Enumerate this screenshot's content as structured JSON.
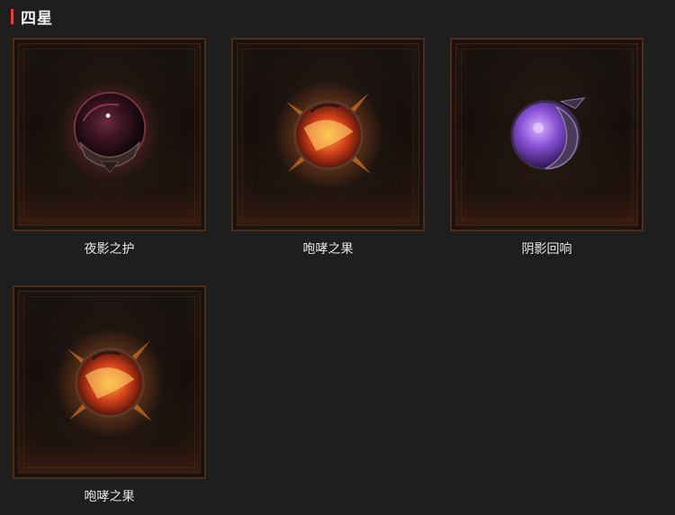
{
  "section": {
    "title": "四星"
  },
  "items": [
    {
      "name": "夜影之护",
      "icon": "dark-nebula-orb-icon"
    },
    {
      "name": "咆哮之果",
      "icon": "flame-fruit-icon"
    },
    {
      "name": "阴影回响",
      "icon": "purple-moon-orb-icon"
    },
    {
      "name": "咆哮之果",
      "icon": "flame-fruit-icon"
    }
  ],
  "colors": {
    "accent": "#e2403a",
    "background": "#1e1e1f",
    "frame_border": "#4b2c1d"
  }
}
